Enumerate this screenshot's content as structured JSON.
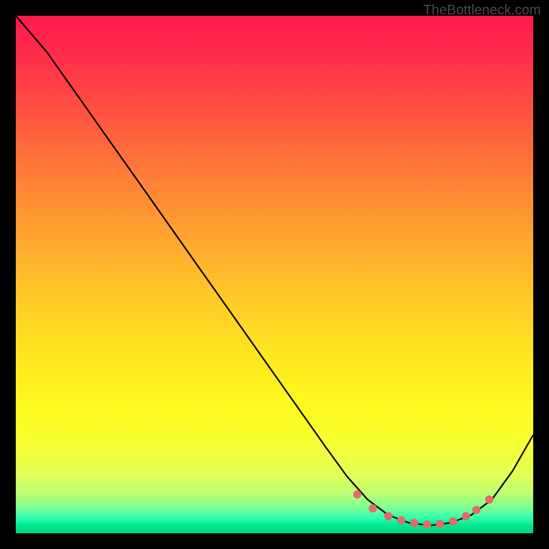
{
  "watermark": "TheBottleneck.com",
  "chart_data": {
    "type": "line",
    "title": "",
    "xlabel": "",
    "ylabel": "",
    "xlim": [
      0,
      100
    ],
    "ylim": [
      0,
      100
    ],
    "series": [
      {
        "name": "curve",
        "x": [
          0,
          6,
          12,
          18,
          24,
          30,
          36,
          42,
          48,
          54,
          60,
          64,
          68,
          72,
          76,
          80,
          84,
          88,
          92,
          96,
          100
        ],
        "y": [
          100,
          93,
          84.5,
          76,
          67.5,
          59,
          50.5,
          42,
          33.5,
          25,
          16.5,
          11,
          6.5,
          3.5,
          2,
          1.5,
          2,
          3.5,
          6.5,
          12,
          19
        ]
      }
    ],
    "dots": {
      "name": "highlight-band",
      "x": [
        66,
        69,
        72,
        74.5,
        77,
        79.5,
        82,
        84.5,
        87,
        89,
        91.5
      ],
      "y": [
        7.5,
        4.8,
        3.3,
        2.5,
        2.0,
        1.7,
        1.8,
        2.3,
        3.3,
        4.5,
        6.5
      ]
    },
    "colors": {
      "curve": "#000000",
      "dots": "#e66a6a",
      "background_top": "#ff1a4d",
      "background_mid": "#ffe820",
      "background_bottom": "#00d080",
      "frame": "#000000"
    }
  }
}
